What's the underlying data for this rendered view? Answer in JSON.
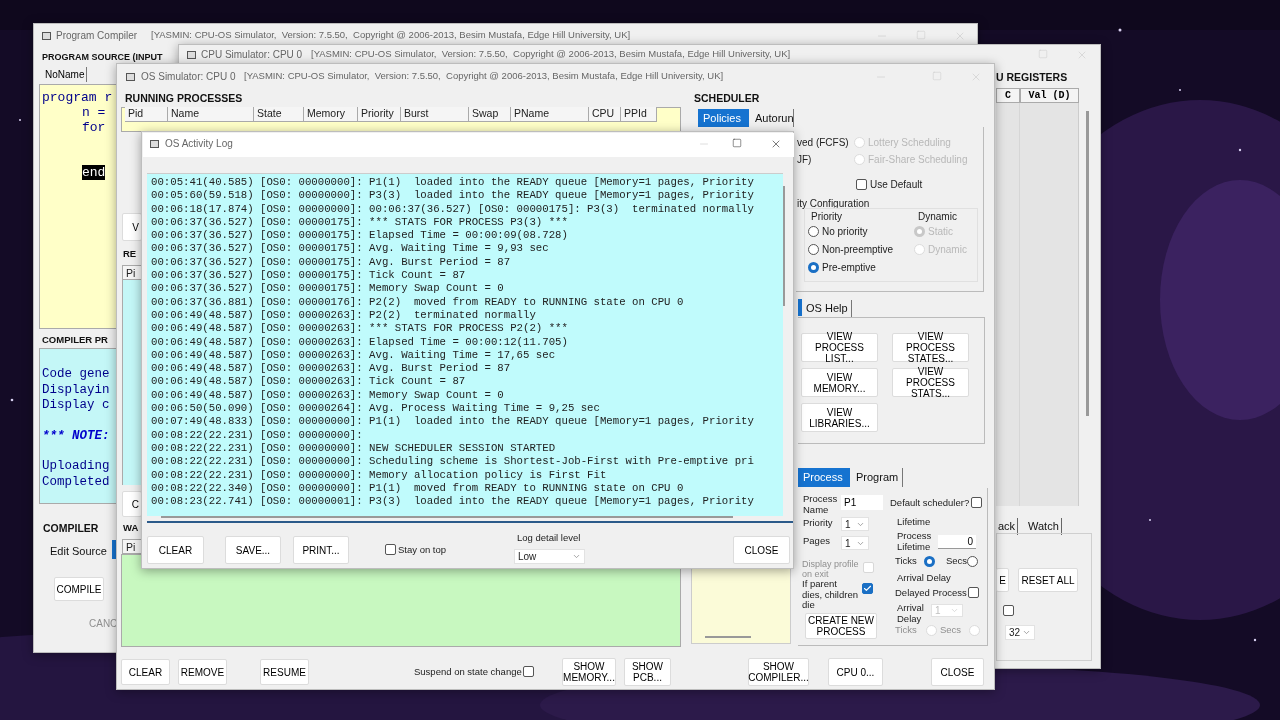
{
  "compiler_window": {
    "title": "Program Compiler",
    "subtitle": "[YASMIN: CPU-OS Simulator,  Version: 7.5.50,  Copyright @ 2006-2013, Besim Mustafa, Edge Hill University, UK]",
    "source_heading": "PROGRAM SOURCE (INPUT",
    "source_tab": "NoName",
    "code_lines": [
      {
        "text": "program r",
        "highlighted": false
      },
      {
        "text": "n =",
        "highlighted": false
      },
      {
        "text": "for",
        "highlighted": false
      },
      {
        "text": "end",
        "highlighted": true
      }
    ],
    "output_heading": "COMPILER PR",
    "output_lines": [
      {
        "text": "Code gene",
        "kind": "plain"
      },
      {
        "text": "Displayin",
        "kind": "plain"
      },
      {
        "text": "Display c",
        "kind": "plain"
      },
      {
        "text": "*** NOTE:",
        "kind": "note"
      },
      {
        "text": "Uploading",
        "kind": "plain"
      },
      {
        "text": "Completed",
        "kind": "plain"
      }
    ],
    "compiler_heading": "COMPILER",
    "edit_tab": "Edit Source",
    "compile_button": "COMPILE",
    "cancel_button": "CANC"
  },
  "cpu_window": {
    "title": "CPU Simulator: CPU 0",
    "subtitle": "[YASMIN: CPU-OS Simulator,  Version: 7.5.50,  Copyright @ 2006-2013, Besim Mustafa, Edge Hill University, UK]",
    "registers_heading": "U REGISTERS",
    "register_columns": [
      "C",
      "Val (D)"
    ],
    "tabs": [
      {
        "label": "ack",
        "selected": false
      },
      {
        "label": "Watch",
        "selected": false
      }
    ],
    "buttons": [
      "E",
      "RESET ALL"
    ],
    "option": {
      "checked": false
    },
    "size_value": "32"
  },
  "os_window": {
    "title": "OS Simulator: CPU 0",
    "subtitle": "[YASMIN: CPU-OS Simulator,  Version: 7.5.50,  Copyright @ 2006-2013, Besim Mustafa, Edge Hill University, UK]",
    "running_heading": "RUNNING PROCESSES",
    "running_columns": [
      "Pid",
      "Name",
      "State",
      "Memory",
      "Priority",
      "Burst",
      "Swap",
      "PName",
      "CPU",
      "PPId"
    ],
    "side_buttons": [
      "V",
      "C"
    ],
    "ready_heading": "RE",
    "ready_column": "Pi",
    "waiting_heading": "WA",
    "waiting_column": "Pi",
    "scheduler": {
      "heading": "SCHEDULER",
      "tabs": [
        {
          "label": "Policies",
          "selected": true
        },
        {
          "label": "Autorun",
          "selected": false
        }
      ],
      "policy_fragments": [
        "ved (FCFS)",
        "JF)"
      ],
      "other_policies": [
        {
          "label": "Lottery Scheduling",
          "selected": false,
          "disabled": true
        },
        {
          "label": "Fair-Share Scheduling",
          "selected": false,
          "disabled": true
        }
      ],
      "use_default": {
        "label": "Use Default",
        "checked": false
      },
      "config_heading": "ity Configuration",
      "priority_heading": "Priority",
      "priority_options": [
        {
          "label": "No priority",
          "selected": false
        },
        {
          "label": "Non-preemptive",
          "selected": false
        },
        {
          "label": "Pre-emptive",
          "selected": true
        }
      ],
      "dynamic_heading": "Dynamic",
      "dynamic_options": [
        {
          "label": "Static",
          "selected": true
        },
        {
          "label": "Dynamic",
          "selected": false
        }
      ]
    },
    "help_tab": "OS Help",
    "help_buttons": [
      "VIEW PROCESS LIST...",
      "VIEW PROCESS STATES...",
      "VIEW MEMORY...",
      "VIEW PROCESS STATS...",
      "VIEW LIBRARIES..."
    ],
    "process": {
      "tabs": [
        {
          "label": "Process",
          "selected": true
        },
        {
          "label": "Program",
          "selected": false
        }
      ],
      "name_label": "Process Name",
      "name_value": "P1",
      "default_scheduler": {
        "label": "Default scheduler?",
        "checked": false
      },
      "priority_label": "Priority",
      "priority_value": "1",
      "pages_label": "Pages",
      "pages_value": "1",
      "lifetime_heading": "Lifetime",
      "lifetime_label": "Process Lifetime",
      "lifetime_value": "0",
      "lifetime_units": [
        {
          "label": "Ticks",
          "selected": true
        },
        {
          "label": "Secs",
          "selected": false
        }
      ],
      "display_profile": {
        "label": "Display profile on exit",
        "checked": false
      },
      "parent_dies": {
        "label": "If parent dies, children die",
        "checked": true
      },
      "arrival_heading": "Arrival Delay",
      "delayed": {
        "label": "Delayed Process",
        "checked": false
      },
      "arrival_label": "Arrival Delay",
      "arrival_value": "1",
      "arrival_units": [
        {
          "label": "Ticks",
          "selected": false
        },
        {
          "label": "Secs",
          "selected": false
        }
      ],
      "create_button": "CREATE NEW PROCESS"
    },
    "bottom_buttons": [
      "CLEAR",
      "REMOVE",
      "RESUME"
    ],
    "suspend": {
      "label": "Suspend on state change",
      "checked": false
    },
    "show_buttons": [
      "SHOW MEMORY...",
      "SHOW PCB..."
    ],
    "right_buttons": [
      "SHOW COMPILER...",
      "CPU 0...",
      "CLOSE"
    ]
  },
  "log_window": {
    "title": "OS Activity Log",
    "lines": [
      "00:05:41(40.585) [OS0: 00000000]: P1(1)  loaded into the READY queue [Memory=1 pages, Priority",
      "00:05:60(59.518) [OS0: 00000000]: P3(3)  loaded into the READY queue [Memory=1 pages, Priority",
      "00:06:18(17.874) [OS0: 00000000]: 00:06:37(36.527) [OS0: 00000175]: P3(3)  terminated normally",
      "00:06:37(36.527) [OS0: 00000175]: *** STATS FOR PROCESS P3(3) ***",
      "00:06:37(36.527) [OS0: 00000175]: Elapsed Time = 00:00:09(08.728)",
      "00:06:37(36.527) [OS0: 00000175]: Avg. Waiting Time = 9,93 sec",
      "00:06:37(36.527) [OS0: 00000175]: Avg. Burst Period = 87",
      "00:06:37(36.527) [OS0: 00000175]: Tick Count = 87",
      "00:06:37(36.527) [OS0: 00000175]: Memory Swap Count = 0",
      "00:06:37(36.881) [OS0: 00000176]: P2(2)  moved from READY to RUNNING state on CPU 0",
      "00:06:49(48.587) [OS0: 00000263]: P2(2)  terminated normally",
      "00:06:49(48.587) [OS0: 00000263]: *** STATS FOR PROCESS P2(2) ***",
      "00:06:49(48.587) [OS0: 00000263]: Elapsed Time = 00:00:12(11.705)",
      "00:06:49(48.587) [OS0: 00000263]: Avg. Waiting Time = 17,65 sec",
      "00:06:49(48.587) [OS0: 00000263]: Avg. Burst Period = 87",
      "00:06:49(48.587) [OS0: 00000263]: Tick Count = 87",
      "00:06:49(48.587) [OS0: 00000263]: Memory Swap Count = 0",
      "00:06:50(50.090) [OS0: 00000264]: Avg. Process Waiting Time = 9,25 sec",
      "00:07:49(48.833) [OS0: 00000000]: P1(1)  loaded into the READY queue [Memory=1 pages, Priority",
      "00:08:22(22.231) [OS0: 00000000]:",
      "00:08:22(22.231) [OS0: 00000000]: NEW SCHEDULER SESSION STARTED",
      "00:08:22(22.231) [OS0: 00000000]: Scheduling scheme is Shortest-Job-First with Pre-emptive pri",
      "00:08:22(22.231) [OS0: 00000000]: Memory allocation policy is First Fit",
      "00:08:22(22.340) [OS0: 00000000]: P1(1)  moved from READY to RUNNING state on CPU 0",
      "00:08:23(22.741) [OS0: 00000001]: P3(3)  loaded into the READY queue [Memory=1 pages, Priority"
    ],
    "buttons": [
      "CLEAR",
      "SAVE...",
      "PRINT..."
    ],
    "stay_on_top": {
      "label": "Stay on top",
      "checked": false
    },
    "detail_label": "Log detail level",
    "detail_value": "Low",
    "close_button": "CLOSE"
  }
}
